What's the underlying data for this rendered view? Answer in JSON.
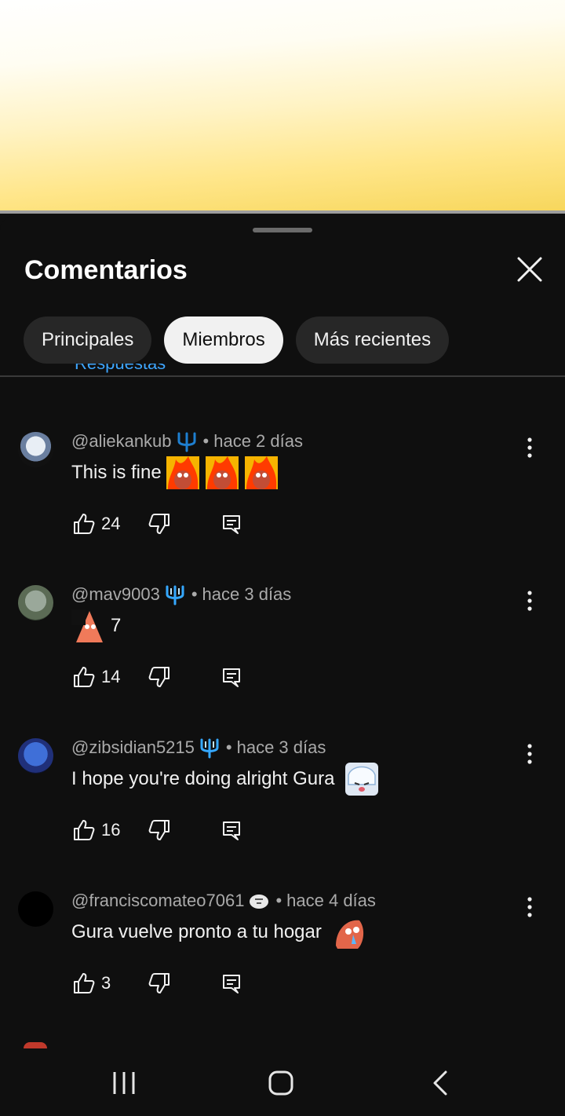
{
  "header": {
    "title": "Comentarios"
  },
  "chips": [
    "Principales",
    "Miembros",
    "Más recientes"
  ],
  "active_chip": "Miembros",
  "peek_text": "Respuestas",
  "comments": [
    {
      "author": "@aliekankub",
      "time": "hace 2 días",
      "text": "This is fine",
      "likes": "24",
      "emoji_count": 3,
      "emoji": "fire-emote"
    },
    {
      "author": "@mav9003",
      "time": "hace 3 días",
      "text": "7",
      "likes": "14",
      "emoji_count": 1,
      "emoji": "patrick-emote"
    },
    {
      "author": "@zibsidian5215",
      "time": "hace 3 días",
      "text": "I hope you're doing alright Gura",
      "likes": "16",
      "emoji_count": 1,
      "emoji": "gura-emote"
    },
    {
      "author": "@franciscomateo7061",
      "time": "hace 4 días",
      "text": "Gura vuelve pronto a tu hogar",
      "likes": "3",
      "emoji_count": 1,
      "emoji": "crying-emote"
    }
  ],
  "colors": {
    "background": "#0f0f0f",
    "chip_bg": "#272727",
    "chip_active_bg": "#f1f1f1",
    "meta_text": "#aaaaaa",
    "badge_blue": "#2f8fd8"
  }
}
